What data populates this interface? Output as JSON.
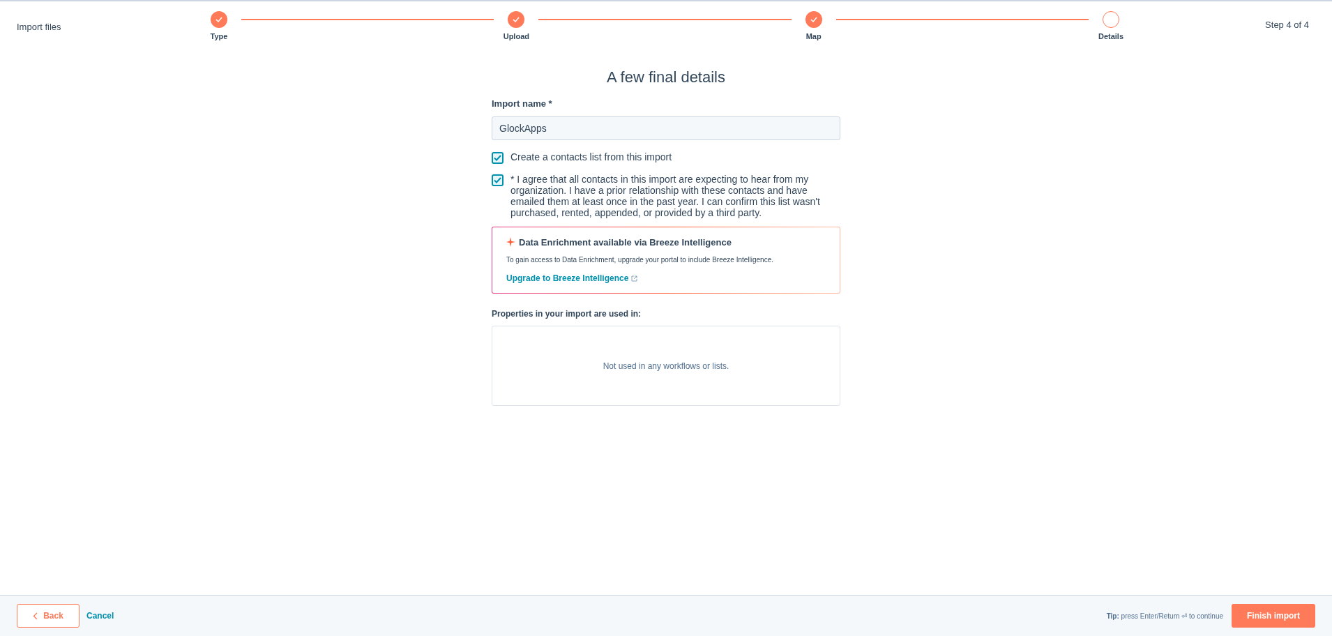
{
  "header": {
    "title": "Import files",
    "step_count": "Step 4 of 4"
  },
  "steps": [
    {
      "label": "Type",
      "completed": true
    },
    {
      "label": "Upload",
      "completed": true
    },
    {
      "label": "Map",
      "completed": true
    },
    {
      "label": "Details",
      "completed": false
    }
  ],
  "form": {
    "heading": "A few final details",
    "import_name": {
      "label": "Import name *",
      "value": "GlockApps"
    },
    "checkboxes": [
      {
        "label": "Create a contacts list from this import",
        "checked": true
      },
      {
        "label": "* I agree that all contacts in this import are expecting to hear from my organization. I have a prior relationship with these contacts and have emailed them at least once in the past year. I can confirm this list wasn't purchased, rented, appended, or provided by a third party.",
        "checked": true
      }
    ],
    "callout": {
      "title": "Data Enrichment available via Breeze Intelligence",
      "text": "To gain access to Data Enrichment, upgrade your portal to include Breeze Intelligence.",
      "link": "Upgrade to Breeze Intelligence"
    },
    "properties": {
      "label": "Properties in your import are used in:",
      "empty_text": "Not used in any workflows or lists."
    }
  },
  "footer": {
    "back": "Back",
    "cancel": "Cancel",
    "tip": "**Tip:** press Enter/Return ⏎ to continue",
    "finish": "Finish import"
  }
}
